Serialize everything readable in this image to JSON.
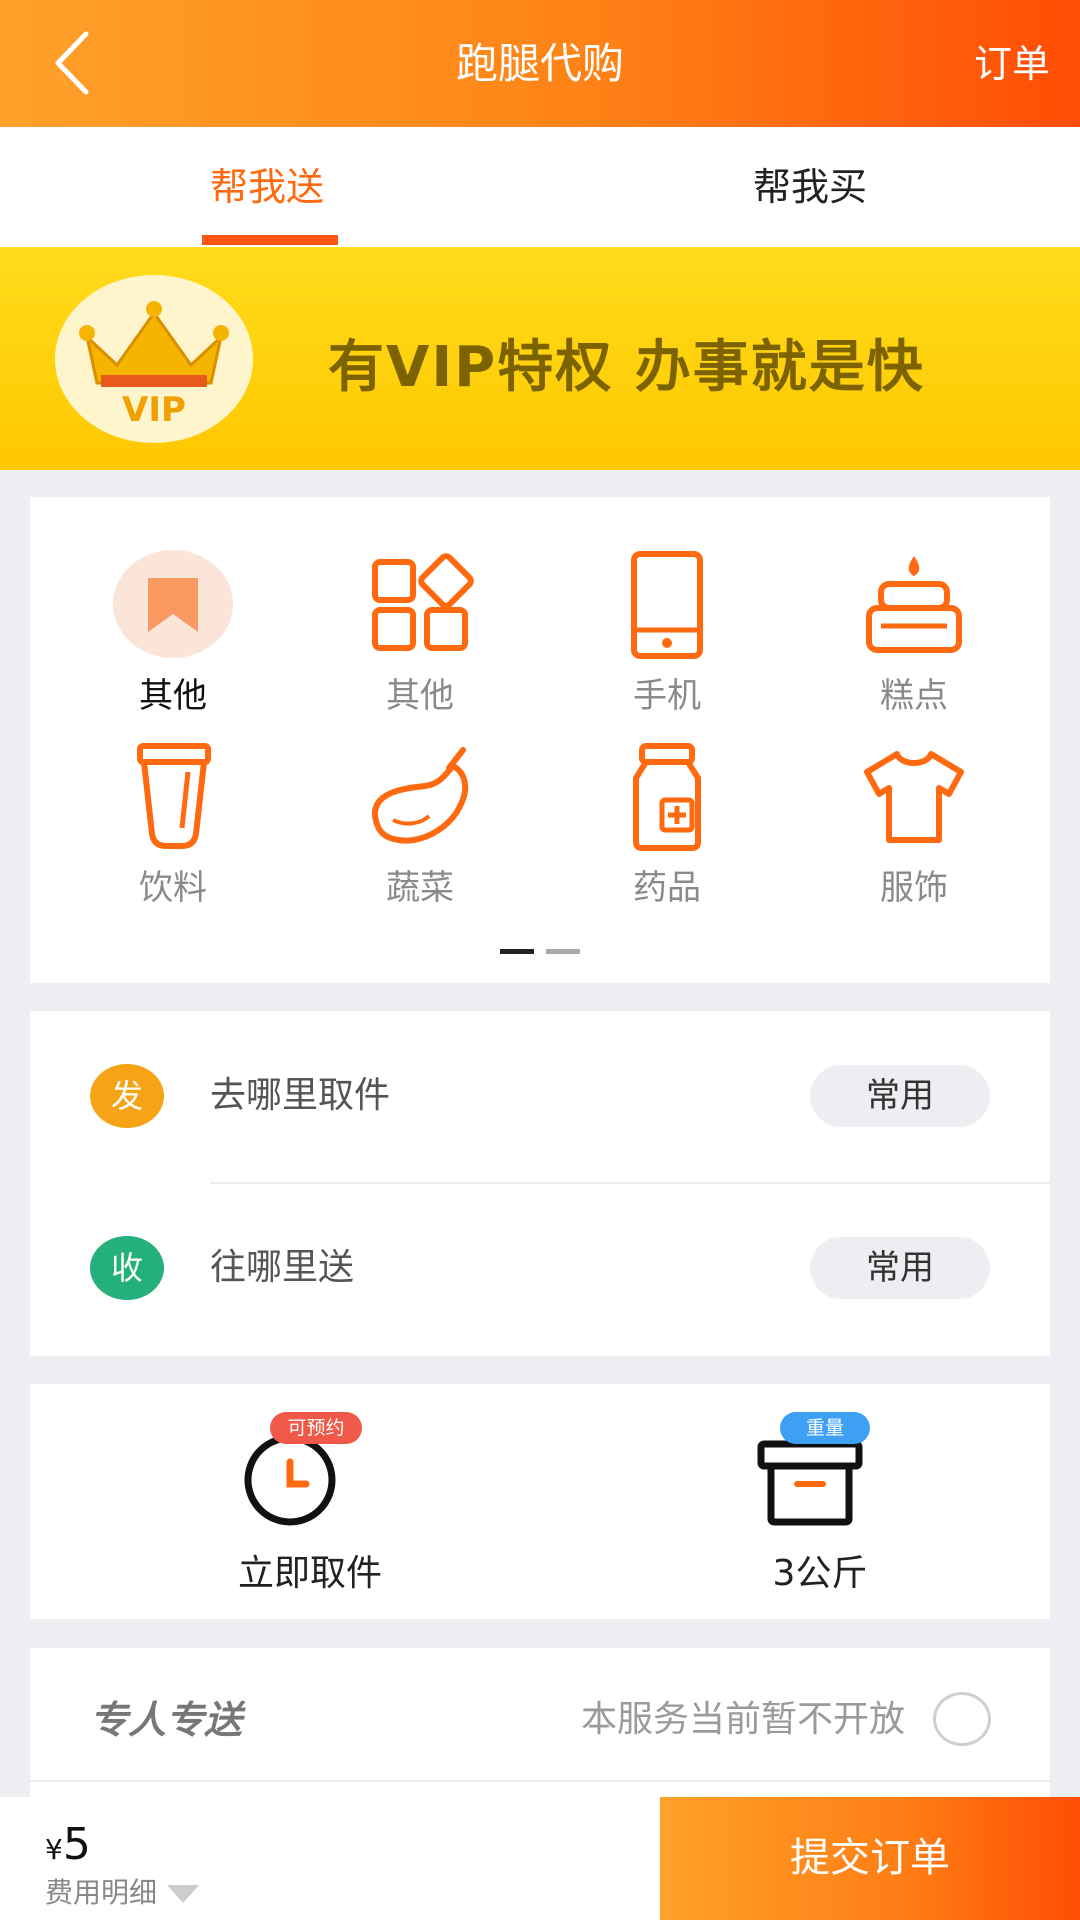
{
  "header": {
    "title": "跑腿代购",
    "order_link": "订单"
  },
  "tabs": [
    {
      "label": "帮我送"
    },
    {
      "label": "帮我买"
    }
  ],
  "vip_banner": {
    "badge_text": "VIP",
    "tagline": "有VIP特权  办事就是快"
  },
  "categories": [
    {
      "label": "其他",
      "icon": "bookmark-icon",
      "selected": true
    },
    {
      "label": "其他",
      "icon": "grid-icon"
    },
    {
      "label": "手机",
      "icon": "phone-icon"
    },
    {
      "label": "糕点",
      "icon": "cake-icon"
    },
    {
      "label": "饮料",
      "icon": "cup-icon"
    },
    {
      "label": "蔬菜",
      "icon": "eggplant-icon"
    },
    {
      "label": "药品",
      "icon": "medicine-bottle-icon"
    },
    {
      "label": "服饰",
      "icon": "tshirt-icon"
    }
  ],
  "pager": {
    "total_pages": 2,
    "current": 1
  },
  "address": {
    "pickup": {
      "badge": "发",
      "placeholder": "去哪里取件",
      "common_label": "常用"
    },
    "delivery": {
      "badge": "收",
      "placeholder": "往哪里送",
      "common_label": "常用"
    }
  },
  "options": {
    "pickup_time": {
      "label": "立即取件",
      "tag": "可预约"
    },
    "weight": {
      "label": "3公斤",
      "tag": "重量"
    }
  },
  "special": {
    "title": "专人专送",
    "note": "本服务当前暂不开放"
  },
  "footer": {
    "currency": "¥",
    "price": "5",
    "fee_detail": "费用明细",
    "submit_label": "提交订单"
  },
  "colors": {
    "accent": "#ff6a10",
    "header_start": "#ffa12a",
    "header_end": "#ff4d05",
    "vip_yellow": "#ffcc00",
    "send_badge": "#f6a416",
    "recv_badge": "#24b07a"
  }
}
